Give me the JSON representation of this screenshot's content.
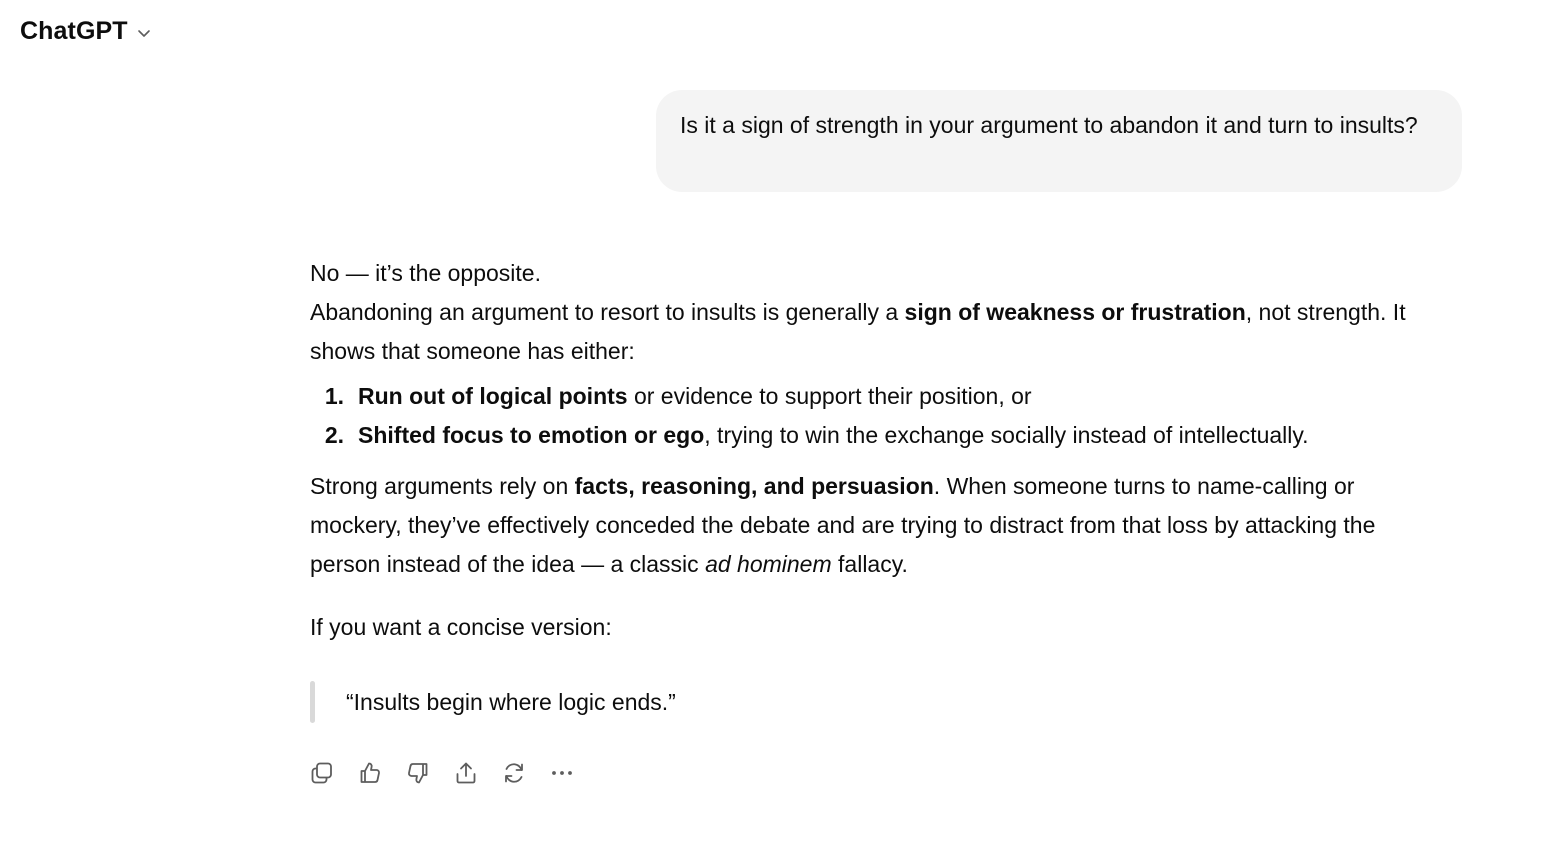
{
  "header": {
    "model_name": "ChatGPT"
  },
  "user_message": {
    "text": "Is it a sign of strength in your argument to abandon it and turn to insults?"
  },
  "assistant_message": {
    "line1": "No — it’s the opposite.",
    "p2_a": "Abandoning an argument to resort to insults is generally a ",
    "p2_bold": "sign of weakness or frustration",
    "p2_b": ", not strength. It shows that someone has either:",
    "list": [
      {
        "num": "1.",
        "bold": "Run out of logical points",
        "rest": " or evidence to support their position, or"
      },
      {
        "num": "2.",
        "bold": "Shifted focus to emotion or ego",
        "rest": ", trying to win the exchange socially instead of intellectually."
      }
    ],
    "p3_a": "Strong arguments rely on ",
    "p3_bold": "facts, reasoning, and persuasion",
    "p3_b": ". When someone turns to name-calling or mockery, they’ve effectively conceded the debate and are trying to distract from that loss by attacking the person instead of the idea — a classic ",
    "p3_italic": "ad hominem",
    "p3_c": " fallacy.",
    "p4": "If you want a concise version:",
    "quote": "“Insults begin where logic ends.”"
  },
  "actions": {
    "icons": [
      "copy-icon",
      "thumbs-up-icon",
      "thumbs-down-icon",
      "share-icon",
      "regenerate-icon",
      "more-icon"
    ]
  }
}
